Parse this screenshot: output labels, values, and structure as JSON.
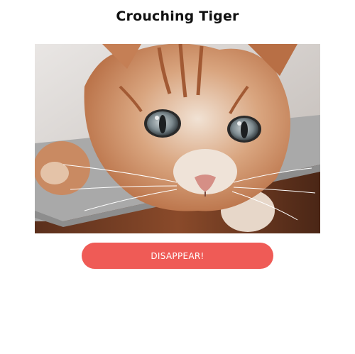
{
  "page": {
    "title": "Crouching Tiger"
  },
  "image": {
    "alt": "Close-up photo of an orange tabby cat crouching on a grey cushion",
    "subject_icon": "cat-photo"
  },
  "button": {
    "label": "DISAPPEAR!",
    "color": "#ef5b56"
  }
}
